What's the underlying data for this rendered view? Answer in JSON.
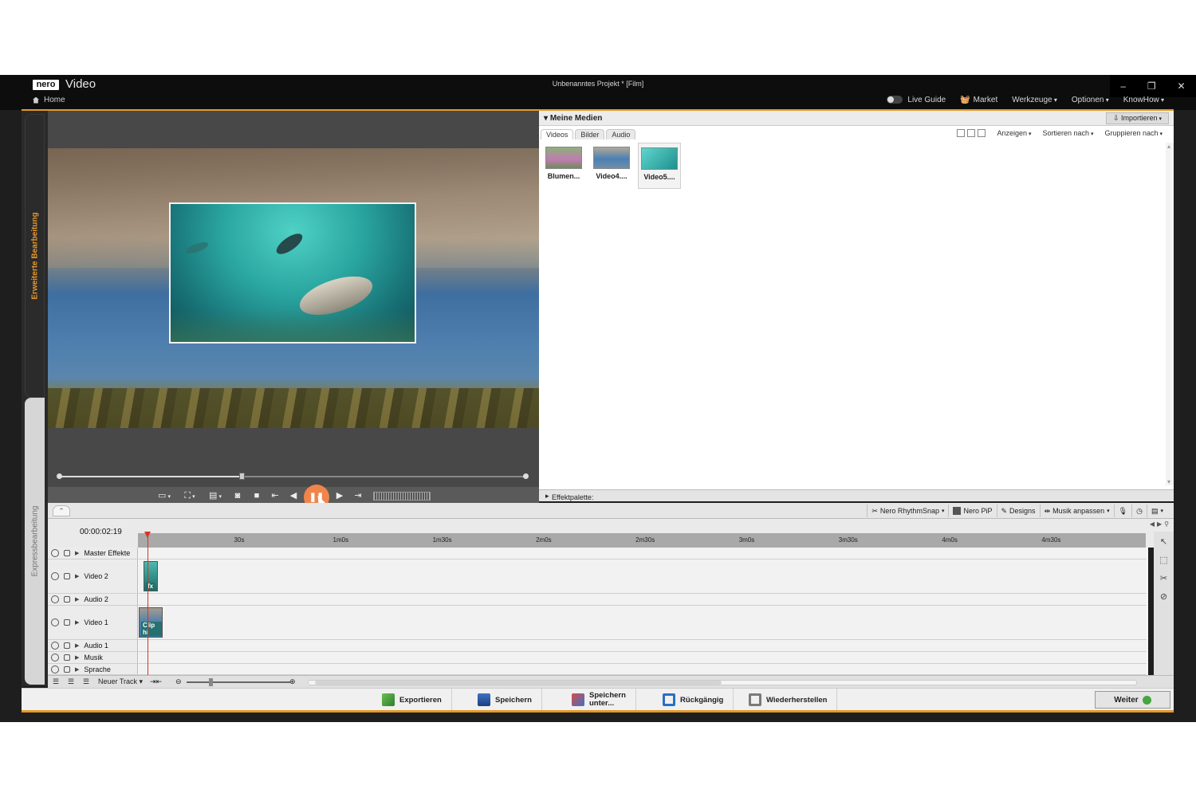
{
  "app": {
    "brand_logo": "nero",
    "product": "Video",
    "home_label": "Home",
    "window_title": "Unbenanntes Projekt * [Film]",
    "win_controls": [
      "–",
      "❐",
      "✕"
    ]
  },
  "menu": {
    "live_guide": "Live Guide",
    "market": "Market",
    "werkzeuge": "Werkzeuge",
    "optionen": "Optionen",
    "knowhow": "KnowHow"
  },
  "side_tabs": {
    "advanced": "Erweiterte Bearbeitung",
    "express": "Expressbearbeitung"
  },
  "preview": {
    "progress": 0.39
  },
  "media": {
    "title": "Meine Medien",
    "import": "Importieren",
    "tabs": [
      "Videos",
      "Bilder",
      "Audio"
    ],
    "anzeigen": "Anzeigen",
    "sortieren": "Sortieren nach",
    "gruppieren": "Gruppieren nach",
    "items": [
      "Blumen...",
      "Video4....",
      "Video5...."
    ]
  },
  "effect_palette": "Effektpalette:",
  "timeline_toolbar": {
    "rhythmsnap": "Nero RhythmSnap",
    "pip": "Nero PiP",
    "designs": "Designs",
    "music": "Musik anpassen"
  },
  "timeline": {
    "timecode": "00:00:02:19",
    "ticks": [
      "30s",
      "1m0s",
      "1m30s",
      "2m0s",
      "2m30s",
      "3m0s",
      "3m30s",
      "4m0s",
      "4m30s"
    ],
    "tracks": [
      "Master Effekte",
      "Video 2",
      "Audio 2",
      "Video 1",
      "Audio 1",
      "Musik",
      "Sprache"
    ],
    "clip_fx_label": "fx",
    "clip_v1_label": "Clip hi",
    "new_track": "Neuer Track"
  },
  "actions": {
    "export": "Exportieren",
    "save": "Speichern",
    "save_as_1": "Speichern",
    "save_as_2": "unter...",
    "undo": "Rückgängig",
    "redo": "Wiederherstellen",
    "next": "Weiter"
  },
  "colors": {
    "accent_orange": "#e39a26",
    "playhead": "#dd3322",
    "pause_button": "#f0854a"
  }
}
